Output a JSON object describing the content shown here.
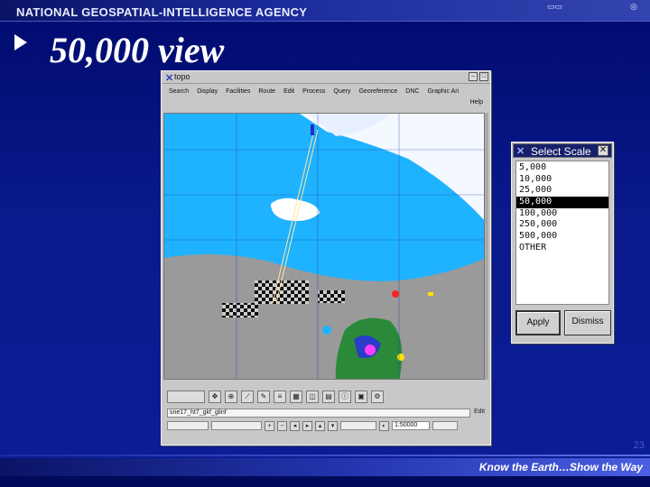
{
  "header": {
    "agency": "NATIONAL GEOSPATIAL-INTELLIGENCE AGENCY"
  },
  "slide": {
    "title": "50,000 view",
    "page_number": "23",
    "tagline": "Know the Earth…Show the Way"
  },
  "app": {
    "window_title": "topo",
    "menu": [
      "Search",
      "Display",
      "Facilities",
      "Route",
      "Edit",
      "Process",
      "Query",
      "Georeference",
      "DNC",
      "Graphic Ari"
    ],
    "help": "Help",
    "file_field": "sne17_ht7_gkf_glinf",
    "edit_label": "Edit",
    "scale_value": "1:50000"
  },
  "dialog": {
    "title": "Select Scale",
    "options": [
      "5,000",
      "10,000",
      "25,000",
      "50,000",
      "100,000",
      "250,000",
      "500,000",
      "OTHER"
    ],
    "selected": "50,000",
    "apply_label": "Apply",
    "dismiss_label": "Dismiss"
  },
  "colors": {
    "background": "#0a1a8c",
    "sea": "#1fb2ff",
    "land": "#9a9a9a",
    "selection": "#000000"
  }
}
